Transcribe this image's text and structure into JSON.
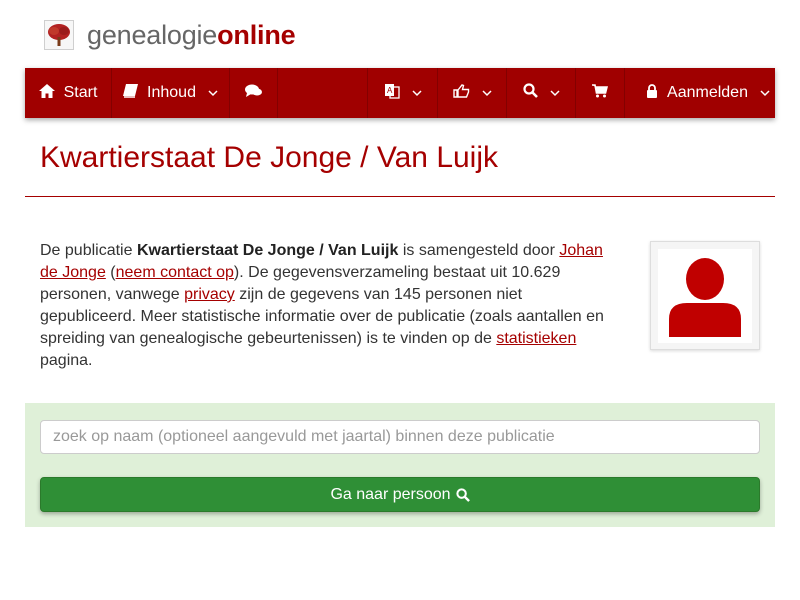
{
  "brand": {
    "part1": "genealogie",
    "part2": "online",
    "logo_icon": "tree-icon"
  },
  "nav": {
    "start_label": "Start",
    "contents_label": "Inhoud",
    "login_label": "Aanmelden",
    "icons": [
      "home-icon",
      "book-icon",
      "comments-icon",
      "language-icon",
      "thumbs-up-icon",
      "search-icon",
      "shopping-cart-icon",
      "lock-icon"
    ]
  },
  "page": {
    "title": "Kwartierstaat De Jonge / Van Luijk"
  },
  "intro": {
    "t1": "De publicatie ",
    "pub_name": "Kwartierstaat De Jonge / Van Luijk",
    "t2": " is samengesteld door ",
    "author": "Johan de Jonge",
    "t3": " (",
    "contact": "neem contact op",
    "t4": "). De gegevensverzameling bestaat uit 10.629 personen, vanwege ",
    "privacy": "privacy",
    "t5": " zijn de gegevens van 145 personen niet gepubliceerd. Meer statistische informatie over de publicatie (zoals aantallen en spreiding van genealogische gebeurtenissen) is te vinden op de ",
    "stats": "statistieken",
    "t6": " pagina."
  },
  "search": {
    "placeholder": "zoek op naam (optioneel aangevuld met jaartal) binnen deze publicatie",
    "button_label": "Ga naar persoon"
  },
  "colors": {
    "brand_red": "#a00000",
    "panel_green": "#dff0d8",
    "button_green": "#2f8f36"
  }
}
